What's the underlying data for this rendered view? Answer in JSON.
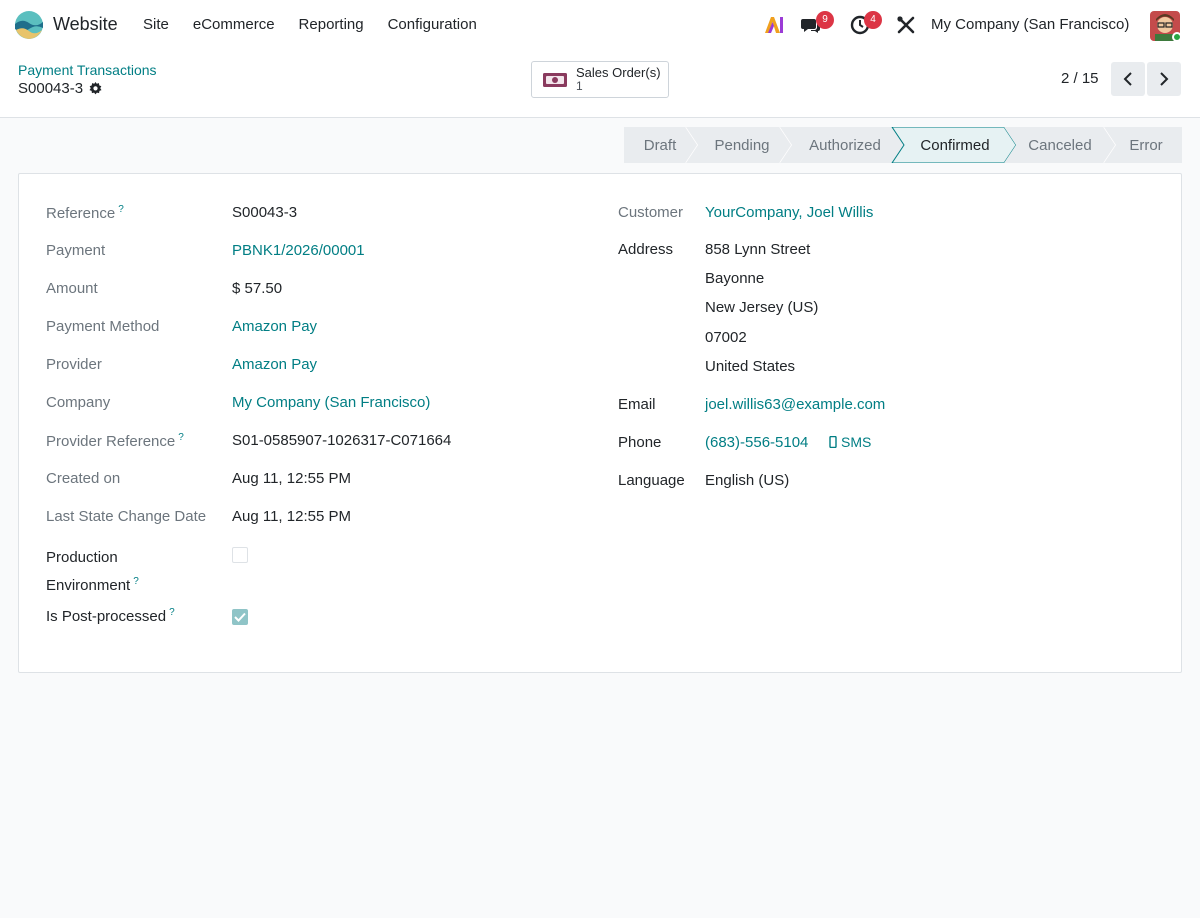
{
  "navbar": {
    "app_name": "Website",
    "menu": [
      "Site",
      "eCommerce",
      "Reporting",
      "Configuration"
    ],
    "messages_count": "9",
    "activities_count": "4",
    "company": "My Company (San Francisco)"
  },
  "control": {
    "breadcrumb": "Payment Transactions",
    "record_name": "S00043-3",
    "smart_button": {
      "label": "Sales Order(s)",
      "count": "1"
    },
    "pager": "2 / 15"
  },
  "statusbar": {
    "stages": [
      "Draft",
      "Pending",
      "Authorized",
      "Confirmed",
      "Canceled",
      "Error"
    ],
    "active": "Confirmed"
  },
  "form": {
    "left": [
      {
        "label": "Reference",
        "help": "?",
        "value": "S00043-3",
        "link": false
      },
      {
        "label": "Payment",
        "value": "PBNK1/2026/00001",
        "link": true
      },
      {
        "label": "Amount",
        "value": "$ 57.50",
        "link": false
      },
      {
        "label": "Payment Method",
        "value": "Amazon Pay",
        "link": true
      },
      {
        "label": "Provider",
        "value": "Amazon Pay",
        "link": true
      },
      {
        "label": "Company",
        "value": "My Company (San Francisco)",
        "link": true
      },
      {
        "label": "Provider Reference",
        "help": "?",
        "value": "S01-0585907-1026317-C071664",
        "link": false
      },
      {
        "label": "Created on",
        "value": "Aug 11, 12:55 PM",
        "link": false
      },
      {
        "label": "Last State Change Date",
        "value": "Aug 11, 12:55 PM",
        "link": false
      }
    ],
    "production_env": {
      "label_line1": "Production",
      "label_line2": "Environment",
      "help": "?",
      "checked": false
    },
    "post_processed": {
      "label": "Is Post-processed",
      "help": "?",
      "checked": true
    },
    "customer": {
      "label": "Customer",
      "value": "YourCompany, Joel Willis"
    },
    "address": {
      "label": "Address",
      "lines": [
        "858 Lynn Street",
        "Bayonne",
        "New Jersey (US)",
        "07002",
        "United States"
      ]
    },
    "email": {
      "label": "Email",
      "value": "joel.willis63@example.com"
    },
    "phone": {
      "label": "Phone",
      "value": "(683)-556-5104",
      "sms": "SMS"
    },
    "language": {
      "label": "Language",
      "value": "English (US)"
    }
  }
}
